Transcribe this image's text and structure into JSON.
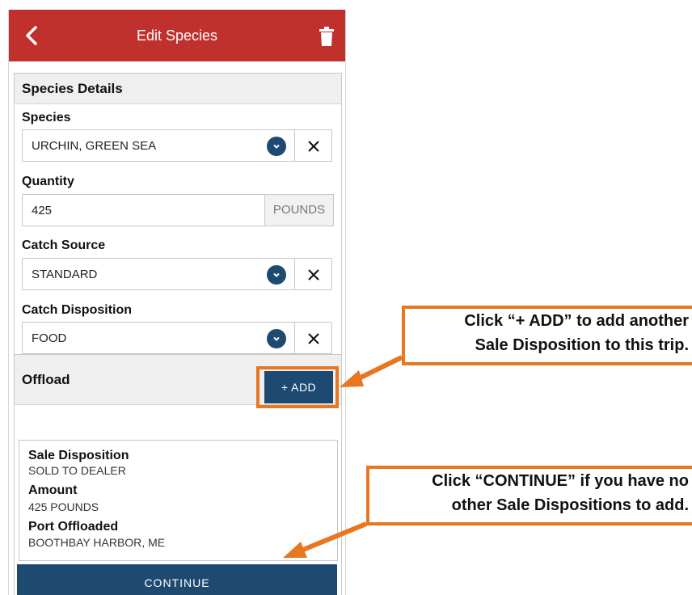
{
  "header": {
    "title": "Edit Species",
    "back_icon": "chevron-left-icon",
    "delete_icon": "trash-icon",
    "bg": "#c0312e"
  },
  "species_details": {
    "heading": "Species Details",
    "species": {
      "label": "Species",
      "value": "URCHIN, GREEN SEA"
    },
    "quantity": {
      "label": "Quantity",
      "value": "425",
      "unit": "POUNDS"
    },
    "catch_source": {
      "label": "Catch Source",
      "value": "STANDARD"
    },
    "catch_disposition": {
      "label": "Catch Disposition",
      "value": "FOOD"
    }
  },
  "offload": {
    "heading": "Offload",
    "add_label": "+ ADD",
    "card": {
      "sale_label": "Sale Disposition",
      "sale_value": "SOLD TO DEALER",
      "amount_label": "Amount",
      "amount_value": "425 POUNDS",
      "port_label": "Port Offloaded",
      "port_value": "BOOTHBAY HARBOR, ME"
    }
  },
  "continue_label": "CONTINUE",
  "callouts": {
    "add_line1": "Click “+ ADD” to add another",
    "add_line2": "Sale Disposition to this trip.",
    "continue_line1": "Click “CONTINUE” if you have no",
    "continue_line2": "other Sale Dispositions to add."
  },
  "colors": {
    "primary": "#1e4a72",
    "accent": "#e87722"
  }
}
